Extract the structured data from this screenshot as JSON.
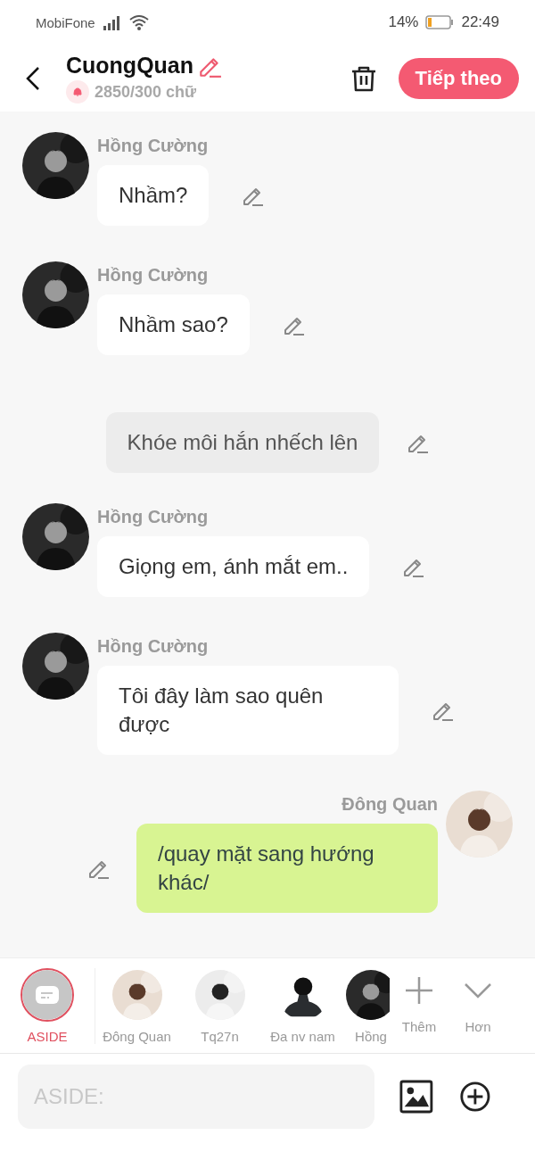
{
  "status_bar": {
    "carrier": "MobiFone",
    "battery": "14%",
    "time": "22:49"
  },
  "header": {
    "title": "CuongQuan",
    "count": "2850/300 chữ",
    "next_button": "Tiếp theo"
  },
  "messages": [
    {
      "kind": "left",
      "sender": "Hồng Cường",
      "text": "Nhầm?"
    },
    {
      "kind": "left",
      "sender": "Hồng Cường",
      "text": "Nhầm sao?"
    },
    {
      "kind": "aside",
      "text": "Khóe môi hắn nhếch lên"
    },
    {
      "kind": "left",
      "sender": "Hồng Cường",
      "text": "Giọng em, ánh mắt em.."
    },
    {
      "kind": "left",
      "sender": "Hồng Cường",
      "text": "Tôi đây làm sao quên được"
    },
    {
      "kind": "right",
      "sender": "Đông Quan",
      "text": "/quay mặt sang hướng khác/"
    }
  ],
  "characters": [
    {
      "kind": "aside",
      "label": "ASIDE",
      "selected": true
    },
    {
      "kind": "picture",
      "label": "Đông Quan",
      "selected": false
    },
    {
      "kind": "picture",
      "label": "Tq27n",
      "selected": false
    },
    {
      "kind": "silhouette",
      "label": "Đa nv nam",
      "selected": false
    },
    {
      "kind": "picture",
      "label": "Hồng",
      "selected": false
    }
  ],
  "more_button": "Thêm",
  "expand_button": "Hơn",
  "input": {
    "placeholder": "ASIDE:"
  }
}
